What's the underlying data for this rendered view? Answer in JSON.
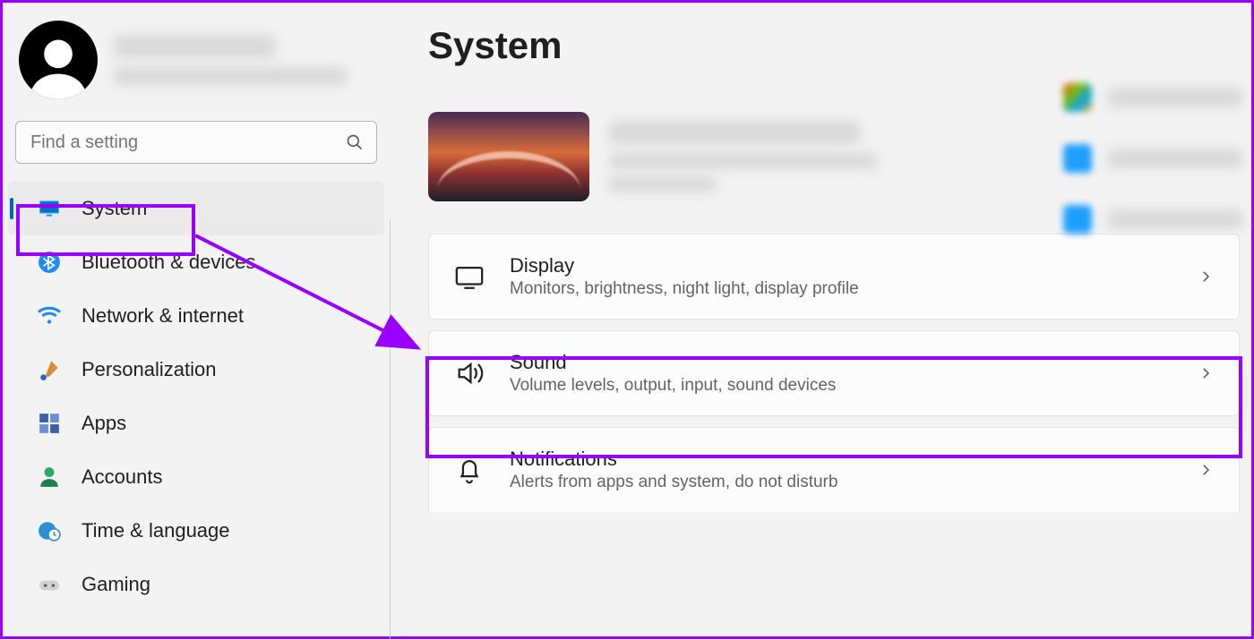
{
  "user": {
    "avatar": "user-avatar"
  },
  "search": {
    "placeholder": "Find a setting"
  },
  "nav": [
    {
      "key": "system",
      "label": "System",
      "icon": "monitor-icon",
      "active": true
    },
    {
      "key": "bluetooth",
      "label": "Bluetooth & devices",
      "icon": "bluetooth-icon"
    },
    {
      "key": "network",
      "label": "Network & internet",
      "icon": "wifi-icon"
    },
    {
      "key": "personalization",
      "label": "Personalization",
      "icon": "brush-icon"
    },
    {
      "key": "apps",
      "label": "Apps",
      "icon": "apps-icon"
    },
    {
      "key": "accounts",
      "label": "Accounts",
      "icon": "person-icon"
    },
    {
      "key": "time",
      "label": "Time & language",
      "icon": "globe-clock-icon"
    },
    {
      "key": "gaming",
      "label": "Gaming",
      "icon": "gamepad-icon"
    }
  ],
  "page": {
    "title": "System"
  },
  "settings": [
    {
      "key": "display",
      "title": "Display",
      "sub": "Monitors, brightness, night light, display profile",
      "icon": "display-icon"
    },
    {
      "key": "sound",
      "title": "Sound",
      "sub": "Volume levels, output, input, sound devices",
      "icon": "speaker-icon"
    },
    {
      "key": "notifications",
      "title": "Notifications",
      "sub": "Alerts from apps and system, do not disturb",
      "icon": "bell-icon"
    }
  ],
  "colors": {
    "accent": "#0067c0",
    "highlight": "#9a00ff"
  }
}
